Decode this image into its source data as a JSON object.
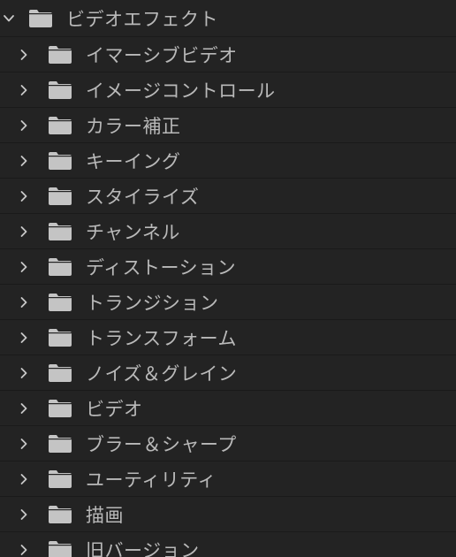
{
  "tree": {
    "root": {
      "label": "ビデオエフェクト",
      "icon": "folder-icon",
      "expanded": true
    },
    "children": [
      {
        "label": "イマーシブビデオ",
        "icon": "folder-icon"
      },
      {
        "label": "イメージコントロール",
        "icon": "folder-icon"
      },
      {
        "label": "カラー補正",
        "icon": "folder-icon"
      },
      {
        "label": "キーイング",
        "icon": "folder-icon"
      },
      {
        "label": "スタイライズ",
        "icon": "folder-icon"
      },
      {
        "label": "チャンネル",
        "icon": "folder-icon"
      },
      {
        "label": "ディストーション",
        "icon": "folder-icon"
      },
      {
        "label": "トランジション",
        "icon": "folder-icon"
      },
      {
        "label": "トランスフォーム",
        "icon": "folder-icon"
      },
      {
        "label": "ノイズ＆グレイン",
        "icon": "folder-icon"
      },
      {
        "label": "ビデオ",
        "icon": "folder-icon"
      },
      {
        "label": "ブラー＆シャープ",
        "icon": "folder-icon"
      },
      {
        "label": "ユーティリティ",
        "icon": "folder-icon"
      },
      {
        "label": "描画",
        "icon": "folder-icon"
      },
      {
        "label": "旧バージョン",
        "icon": "folder-icon"
      }
    ]
  },
  "colors": {
    "background": "#232323",
    "row_divider": "#1a1a1a",
    "text": "#b9b9b9",
    "folder": "#c4c4c4",
    "chevron": "#c8c8c8"
  }
}
